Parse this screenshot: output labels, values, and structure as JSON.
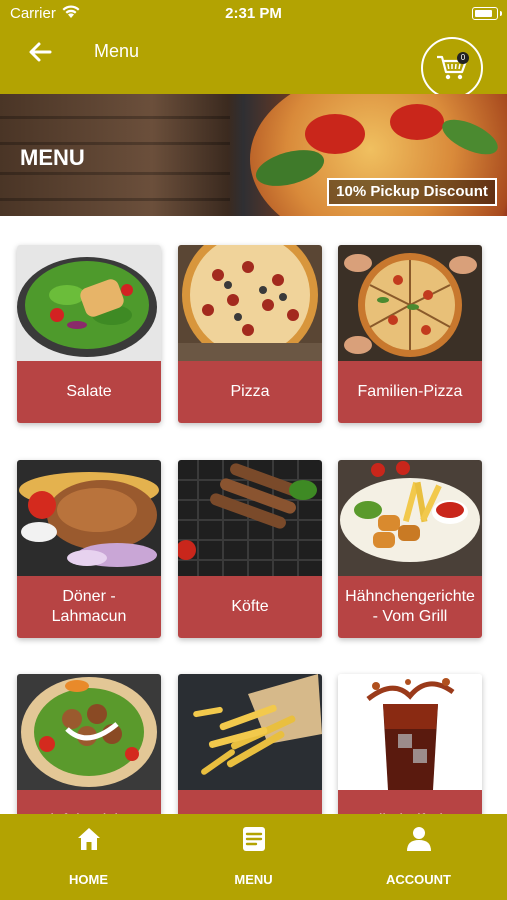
{
  "status": {
    "carrier": "Carrier",
    "time": "2:31 PM"
  },
  "navbar": {
    "title": "Menu",
    "back_icon": "arrow-left-icon"
  },
  "cart": {
    "count": "0",
    "icon": "shopping-cart-icon"
  },
  "hero": {
    "heading": "MENU",
    "discount": "10% Pickup Discount"
  },
  "categories": [
    {
      "label": "Salate"
    },
    {
      "label": "Pizza"
    },
    {
      "label": "Familien-Pizza"
    },
    {
      "label": "Döner - Lahmacun"
    },
    {
      "label": "Köfte"
    },
    {
      "label": "Hähnchengerichte - Vom Grill"
    },
    {
      "label": "Falafelgerichte -"
    },
    {
      "label": ""
    },
    {
      "label": "Alkoholfreie"
    }
  ],
  "tabs": [
    {
      "label": "HOME",
      "icon": "home-icon"
    },
    {
      "label": "MENU",
      "icon": "menu-list-icon"
    },
    {
      "label": "ACCOUNT",
      "icon": "user-icon"
    }
  ],
  "colors": {
    "brand": "#b3a302",
    "card_label": "#b74444"
  }
}
